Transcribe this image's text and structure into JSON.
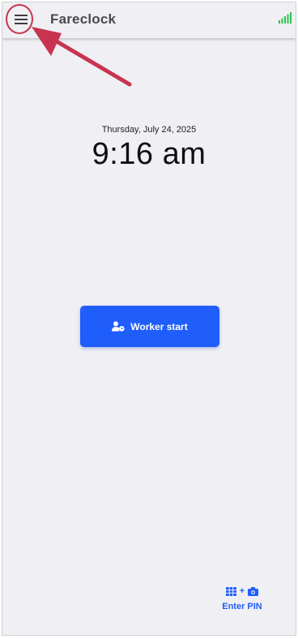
{
  "app": {
    "title": "Fareclock"
  },
  "clock": {
    "date": "Thursday, July 24, 2025",
    "time": "9:16 am"
  },
  "actions": {
    "worker_start_label": "Worker start",
    "pin_plus": "+",
    "enter_pin_label": "Enter PIN"
  },
  "icons": {
    "menu": "hamburger-menu-icon",
    "signal": "signal-strength-icon",
    "worker": "user-clock-icon",
    "grid": "keypad-grid-icon",
    "camera": "camera-icon"
  },
  "colors": {
    "background": "#f0eff4",
    "accent": "#1f5efb",
    "signal": "#2fbf4f",
    "annotation": "#c8344f"
  }
}
